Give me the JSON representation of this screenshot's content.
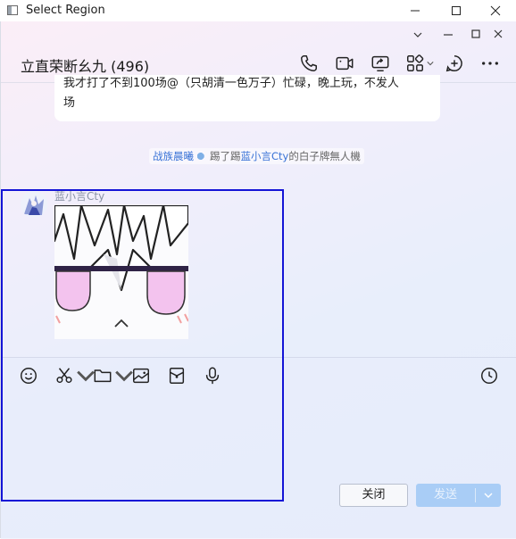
{
  "outer_window": {
    "title": "Select Region",
    "minimize": "—",
    "maximize": "☐",
    "close": "✕"
  },
  "chat": {
    "inner_controls": {
      "collapse": "⌄",
      "minimize": "—",
      "maximize": "☐",
      "close": "✕"
    },
    "title": "立直荣断幺九 (496)",
    "toolbar_icons": [
      "phone-icon",
      "video-icon",
      "screen-share-icon",
      "apps-icon",
      "add-icon",
      "more-icon"
    ]
  },
  "messages": {
    "bubble_line1": "我才打了不到100场@（只胡清一色万子）忙碌，晚上玩，不发人",
    "bubble_line2": "场",
    "system": {
      "actor": "战族晨曦",
      "verb": "踢了踢",
      "target": "蓝小言Cty",
      "suffix": "的白子牌無人機"
    },
    "sender_name": "蓝小言Cty"
  },
  "input_toolbar": [
    "emoji-icon",
    "scissors-icon",
    "folder-icon",
    "image-icon",
    "envelope-icon",
    "microphone-icon",
    "clock-icon"
  ],
  "buttons": {
    "close_label": "关闭",
    "send_label": "发送"
  },
  "colors": {
    "selection": "#1414d6",
    "send_button": "#a9cdf6",
    "link_blue": "#3872d6"
  }
}
